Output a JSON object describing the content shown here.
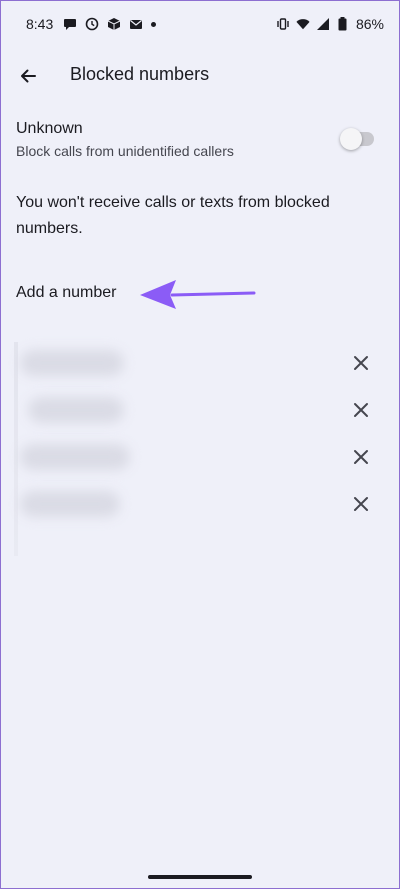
{
  "status_bar": {
    "time": "8:43",
    "battery": "86%",
    "icons": [
      "chat-icon",
      "clock-icon",
      "cube-icon",
      "mail-icon",
      "dot-icon",
      "vibrate-icon",
      "wifi-icon",
      "signal-icon",
      "battery-icon"
    ]
  },
  "app_bar": {
    "title": "Blocked numbers"
  },
  "unknown": {
    "title": "Unknown",
    "subtitle": "Block calls from unidentified callers",
    "enabled": false
  },
  "info_text": "You won't receive calls or texts from blocked numbers.",
  "add_number_label": "Add a number",
  "blocked_numbers_count": 4,
  "colors": {
    "background": "#eff0f9",
    "text": "#1b1b21",
    "annotation_arrow": "#8b5cf6"
  }
}
